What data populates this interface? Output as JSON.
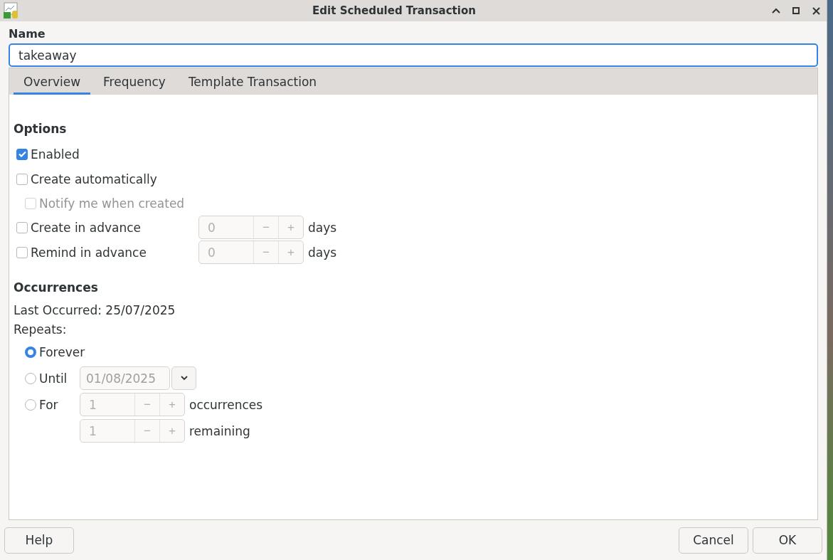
{
  "window": {
    "title": "Edit Scheduled Transaction"
  },
  "name": {
    "label": "Name",
    "value": "takeaway"
  },
  "tabs": [
    {
      "label": "Overview",
      "selected": true
    },
    {
      "label": "Frequency",
      "selected": false
    },
    {
      "label": "Template Transaction",
      "selected": false
    }
  ],
  "options": {
    "heading": "Options",
    "items": [
      {
        "label": "Enabled",
        "checked": true,
        "disabled": false
      },
      {
        "label": "Create automatically",
        "checked": false,
        "disabled": false,
        "children": [
          {
            "label": "Notify me when created",
            "checked": false,
            "disabled": true
          }
        ]
      },
      {
        "label": "Create in advance",
        "checked": false,
        "disabled": false,
        "spin": {
          "value": "0",
          "disabled": true,
          "minus": "−",
          "plus": "+"
        },
        "unit": "days"
      },
      {
        "label": "Remind in advance",
        "checked": false,
        "disabled": false,
        "spin": {
          "value": "0",
          "disabled": true,
          "minus": "−",
          "plus": "+"
        },
        "unit": "days"
      }
    ]
  },
  "occurrences": {
    "heading": "Occurrences",
    "last_occurred": "Last Occurred: 25/07/2025",
    "repeats_label": "Repeats:",
    "choices": [
      {
        "kind": "plain",
        "label": "Forever",
        "selected": true
      },
      {
        "kind": "date",
        "label": "Until",
        "selected": false,
        "date": {
          "value": "01/08/2025",
          "disabled": true
        }
      },
      {
        "kind": "count",
        "label": "For",
        "selected": false,
        "spin": {
          "value": "1",
          "disabled": true,
          "minus": "−",
          "plus": "+"
        },
        "unit": "occurrences"
      }
    ],
    "remaining": {
      "spin": {
        "value": "1",
        "disabled": true,
        "minus": "−",
        "plus": "+"
      },
      "unit": "remaining"
    }
  },
  "buttons": {
    "help": "Help",
    "cancel": "Cancel",
    "ok": "OK"
  }
}
